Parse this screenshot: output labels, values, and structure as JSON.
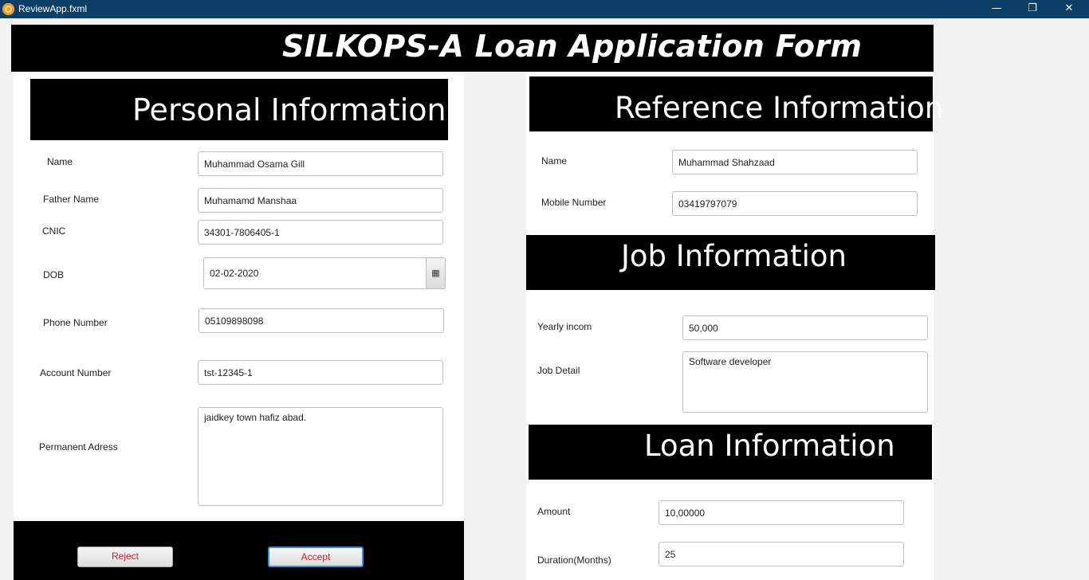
{
  "window": {
    "title": "ReviewApp.fxml",
    "minimize": "—",
    "restore": "❐",
    "close": "✕"
  },
  "form_title": "SILKOPS-A Loan Application Form",
  "personal": {
    "header": "Personal Information",
    "name_label": "Name",
    "name_value": "Muhammad Osama Gill",
    "father_label": "Father  Name",
    "father_value": "Muhamamd Manshaa",
    "cnic_label": "CNIC",
    "cnic_value": "34301-7806405-1",
    "dob_label": "DOB",
    "dob_value": "02-02-2020",
    "dob_icon": "▦",
    "phone_label": "Phone Number",
    "phone_value": "05109898098",
    "account_label": "Account Number",
    "account_value": "tst-12345-1",
    "address_label": "Permanent Adress",
    "address_value": "jaidkey town hafiz abad."
  },
  "reference": {
    "header": "Reference Information",
    "name_label": "Name",
    "name_value": "Muhammad Shahzaad",
    "mobile_label": "Mobile Number",
    "mobile_value": "03419797079"
  },
  "job": {
    "header": "Job Information",
    "income_label": "Yearly incom",
    "income_value": "50,000",
    "detail_label": "Job Detail",
    "detail_value": "Software developer"
  },
  "loan": {
    "header": "Loan Information",
    "amount_label": "Amount",
    "amount_value": "10,00000",
    "duration_label": "Duration(Months)",
    "duration_value": "25"
  },
  "actions": {
    "reject": "Reject",
    "accept": "Accept"
  },
  "colors": {
    "titlebar": "#0d3f66",
    "reject_text": "#c0282d",
    "accept_text": "#c0282d",
    "accept_border": "#3c8fd6"
  }
}
